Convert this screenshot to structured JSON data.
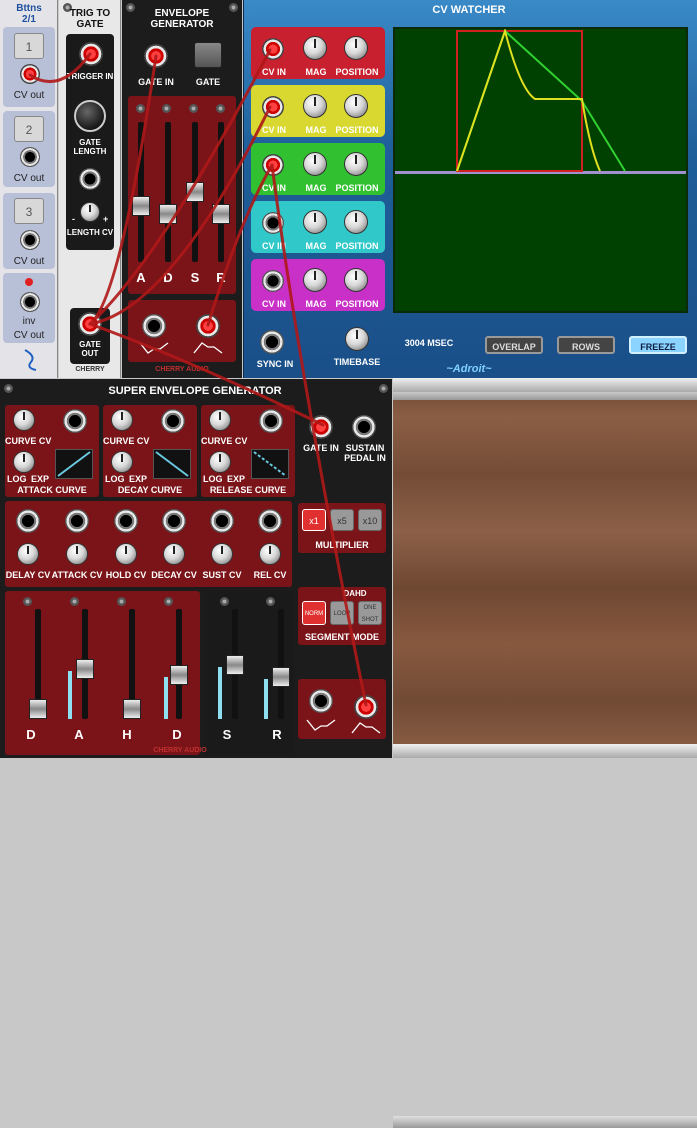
{
  "bttns": {
    "title": "Bttns",
    "subtitle": "2/1",
    "buttons": [
      {
        "num": "1",
        "out": "CV out"
      },
      {
        "num": "2",
        "out": "CV out"
      },
      {
        "num": "3",
        "out": "CV out"
      }
    ],
    "inv_label": "inv",
    "inv_out": "CV out"
  },
  "trig": {
    "title": "TRIG TO GATE",
    "trigger_in": "TRIGGER IN",
    "gate_length": "GATE LENGTH",
    "length_cv": "LENGTH CV",
    "minus": "-",
    "plus": "+",
    "gate_out": "GATE OUT",
    "brand": "CHERRY"
  },
  "envgen": {
    "title": "ENVELOPE GENERATOR",
    "gate_in": "GATE IN",
    "gate": "GATE",
    "sliders": [
      "A",
      "D",
      "S",
      "R"
    ],
    "brand": "CHERRY AUDIO"
  },
  "cvwatcher": {
    "title": "CV WATCHER",
    "channels": [
      {
        "color": "#c8202e",
        "cv": "CV IN",
        "mag": "MAG",
        "pos": "POSITION"
      },
      {
        "color": "#d8d830",
        "cv": "CV IN",
        "mag": "MAG",
        "pos": "POSITION"
      },
      {
        "color": "#30c030",
        "cv": "CV IN",
        "mag": "MAG",
        "pos": "POSITION"
      },
      {
        "color": "#30c8c8",
        "cv": "CV IN",
        "mag": "MAG",
        "pos": "POSITION"
      },
      {
        "color": "#c830c8",
        "cv": "CV IN",
        "mag": "MAG",
        "pos": "POSITION"
      }
    ],
    "sync_in": "SYNC IN",
    "timebase": "TIMEBASE",
    "msec": "3004 MSEC",
    "overlap": "OVERLAP",
    "rows": "ROWS",
    "freeze": "FREEZE",
    "brand": "~Adroit~"
  },
  "superenv": {
    "title": "SUPER ENVELOPE GENERATOR",
    "curves": [
      {
        "cv": "CURVE CV",
        "log": "LOG",
        "exp": "EXP",
        "name": "ATTACK CURVE"
      },
      {
        "cv": "CURVE CV",
        "log": "LOG",
        "exp": "EXP",
        "name": "DECAY CURVE"
      },
      {
        "cv": "CURVE CV",
        "log": "LOG",
        "exp": "EXP",
        "name": "RELEASE CURVE"
      }
    ],
    "gate_in": "GATE IN",
    "sustain_pedal": "SUSTAIN PEDAL IN",
    "cv_labels": [
      "DELAY CV",
      "ATTACK CV",
      "HOLD CV",
      "DECAY CV",
      "SUST CV",
      "REL CV"
    ],
    "multiplier": "MULTIPLIER",
    "mult_opts": [
      "x1",
      "x5",
      "x10"
    ],
    "dahd": "DAHD",
    "segment_mode": "SEGMENT MODE",
    "seg_opts": [
      "NORM",
      "LOOP",
      "ONE SHOT"
    ],
    "sliders": [
      "D",
      "A",
      "H",
      "D",
      "S",
      "R"
    ],
    "brand": "CHERRY AUDIO"
  }
}
